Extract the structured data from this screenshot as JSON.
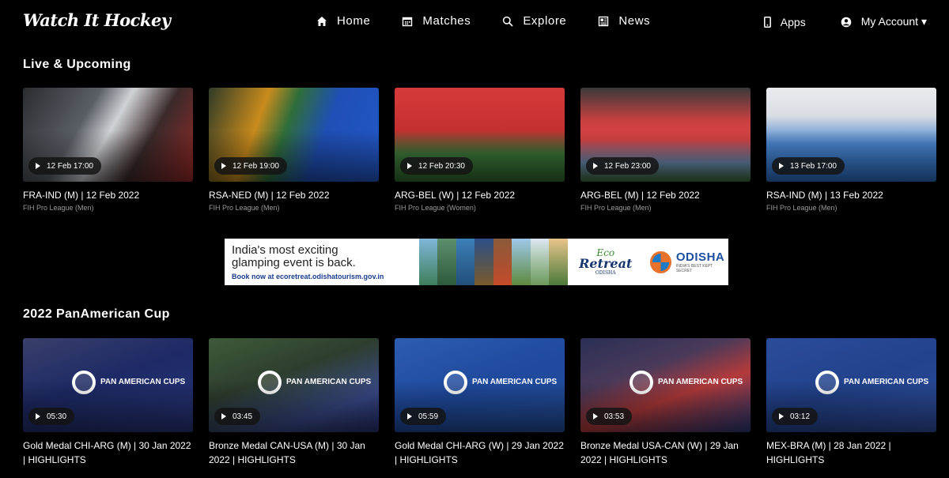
{
  "header": {
    "logo": "Watch It Hockey",
    "nav": [
      {
        "label": "Home",
        "icon": "home-icon"
      },
      {
        "label": "Matches",
        "icon": "calendar-icon"
      },
      {
        "label": "Explore",
        "icon": "search-icon"
      },
      {
        "label": "News",
        "icon": "newspaper-icon"
      }
    ],
    "apps_label": "Apps",
    "account_label": "My Account ▾"
  },
  "live": {
    "title": "Live & Upcoming",
    "cards": [
      {
        "time": "12 Feb 17:00",
        "title": "FRA-IND (M) | 12 Feb 2022",
        "sub": "FIH Pro League (Men)"
      },
      {
        "time": "12 Feb 19:00",
        "title": "RSA-NED (M) | 12 Feb 2022",
        "sub": "FIH Pro League (Men)"
      },
      {
        "time": "12 Feb 20:30",
        "title": "ARG-BEL (W) | 12 Feb 2022",
        "sub": "FIH Pro League (Women)"
      },
      {
        "time": "12 Feb 23:00",
        "title": "ARG-BEL (M) | 12 Feb 2022",
        "sub": "FIH Pro League (Men)"
      },
      {
        "time": "13 Feb 17:00",
        "title": "RSA-IND (M) | 13 Feb 2022",
        "sub": "FIH Pro League (Men)"
      }
    ]
  },
  "ad": {
    "line1": "India's most exciting",
    "line2": "glamping event is back.",
    "line3": "Book now at ecoretreat.odishatourism.gov.in",
    "eco1": "Eco",
    "eco2": "Retreat",
    "eco3": "ODISHA",
    "odisha_name": "ODISHA",
    "odisha_tag": "INDIA'S BEST KEPT SECRET"
  },
  "pan": {
    "title": "2022 PanAmerican Cup",
    "logo_text": "PAN AMERICAN CUPS",
    "cards": [
      {
        "time": "05:30",
        "title": "Gold Medal CHI-ARG (M) | 30 Jan 2022 | HIGHLIGHTS"
      },
      {
        "time": "03:45",
        "title": "Bronze Medal CAN-USA (M) | 30 Jan 2022 | HIGHLIGHTS"
      },
      {
        "time": "05:59",
        "title": "Gold Medal CHI-ARG (W) | 29 Jan 2022 | HIGHLIGHTS"
      },
      {
        "time": "03:53",
        "title": "Bronze Medal USA-CAN (W) | 29 Jan 2022 | HIGHLIGHTS"
      },
      {
        "time": "03:12",
        "title": "MEX-BRA (M) | 28 Jan 2022 | HIGHLIGHTS"
      }
    ]
  },
  "colors": {
    "background": "#000000",
    "ad_link": "#1a3d8f",
    "odisha_blue": "#1c4fa0",
    "eco_green": "#3a8c2e"
  }
}
